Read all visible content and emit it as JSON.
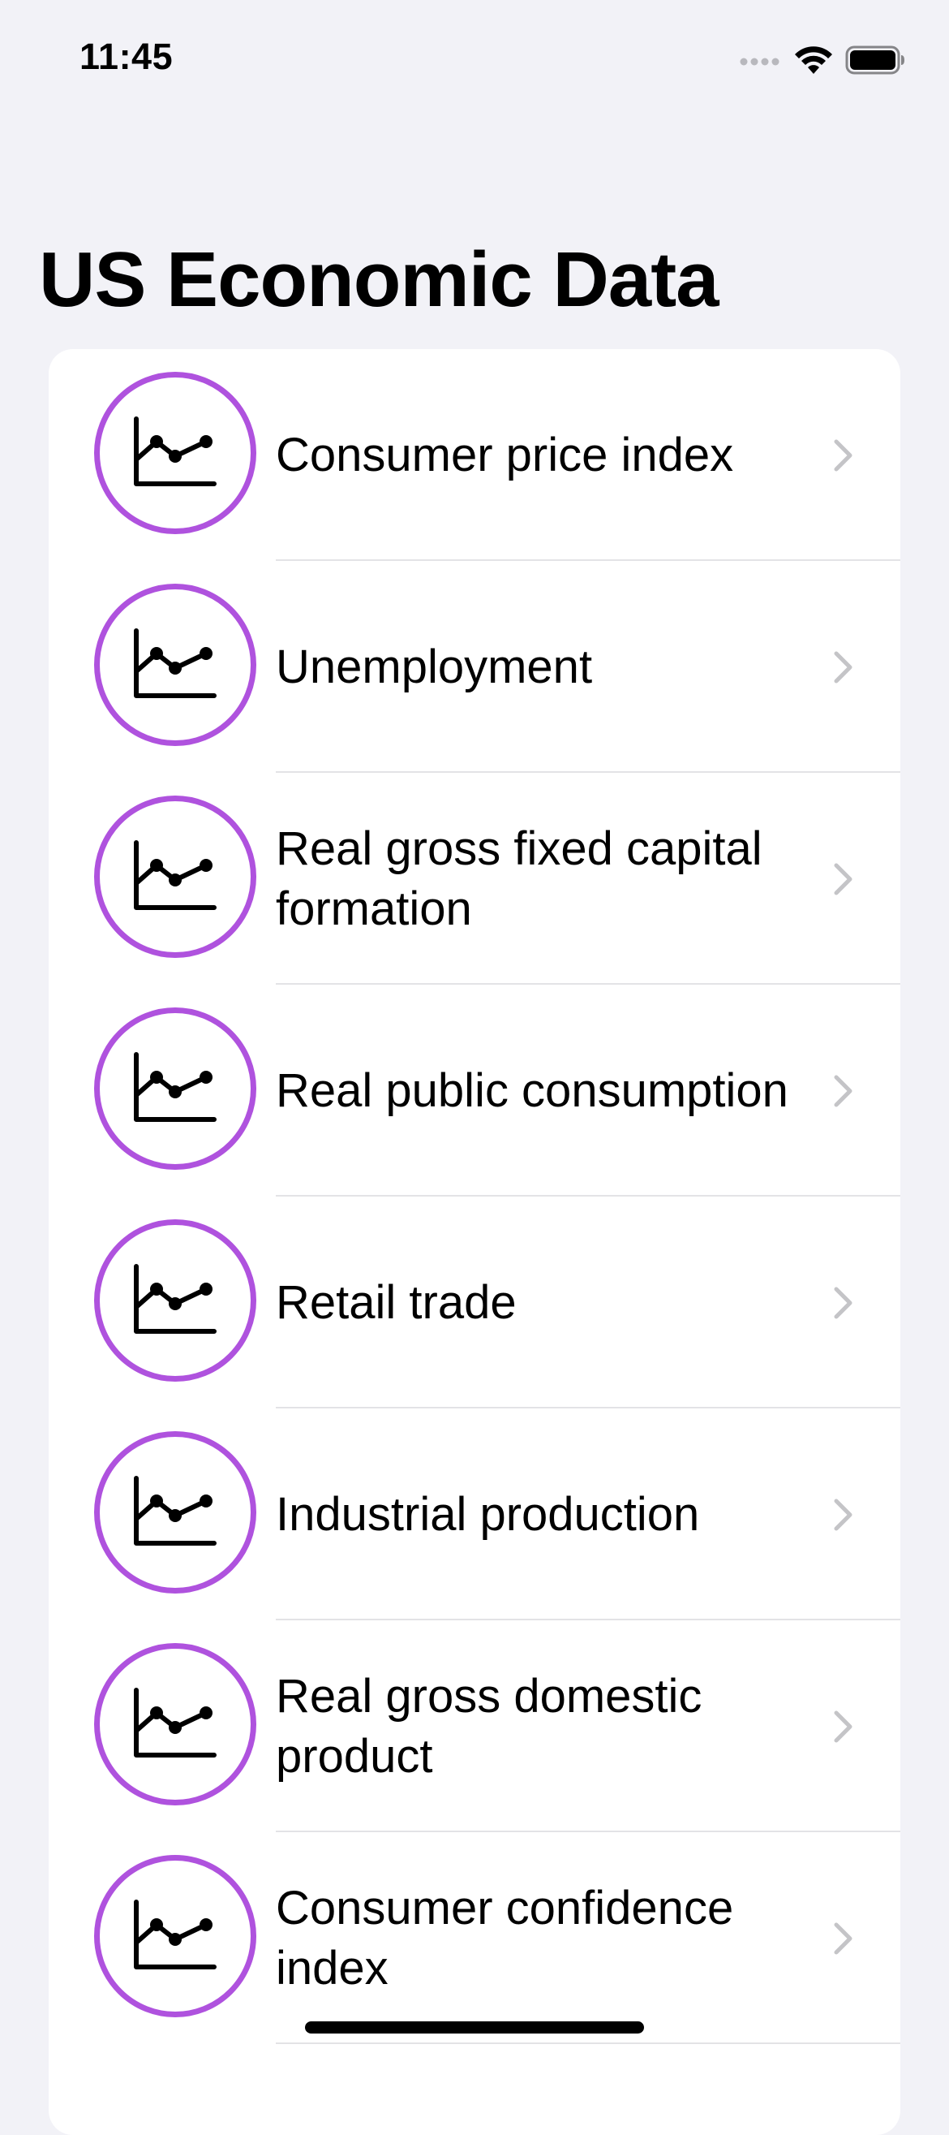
{
  "status_bar": {
    "time": "11:45",
    "icons": [
      "cellular-signal-icon",
      "wifi-icon",
      "battery-icon"
    ]
  },
  "page": {
    "title": "US Economic Data"
  },
  "colors": {
    "background": "#F2F2F7",
    "accent": "#AF52DE",
    "card": "#FFFFFF",
    "chevron": "#C4C4C7"
  },
  "list": {
    "icon": "line-chart-icon",
    "items": [
      {
        "label": "Consumer price index"
      },
      {
        "label": "Unemployment"
      },
      {
        "label": "Real gross fixed capital formation"
      },
      {
        "label": "Real public consumption"
      },
      {
        "label": "Retail trade"
      },
      {
        "label": "Industrial production"
      },
      {
        "label": "Real gross domestic product"
      },
      {
        "label": "Consumer confidence index"
      }
    ]
  }
}
